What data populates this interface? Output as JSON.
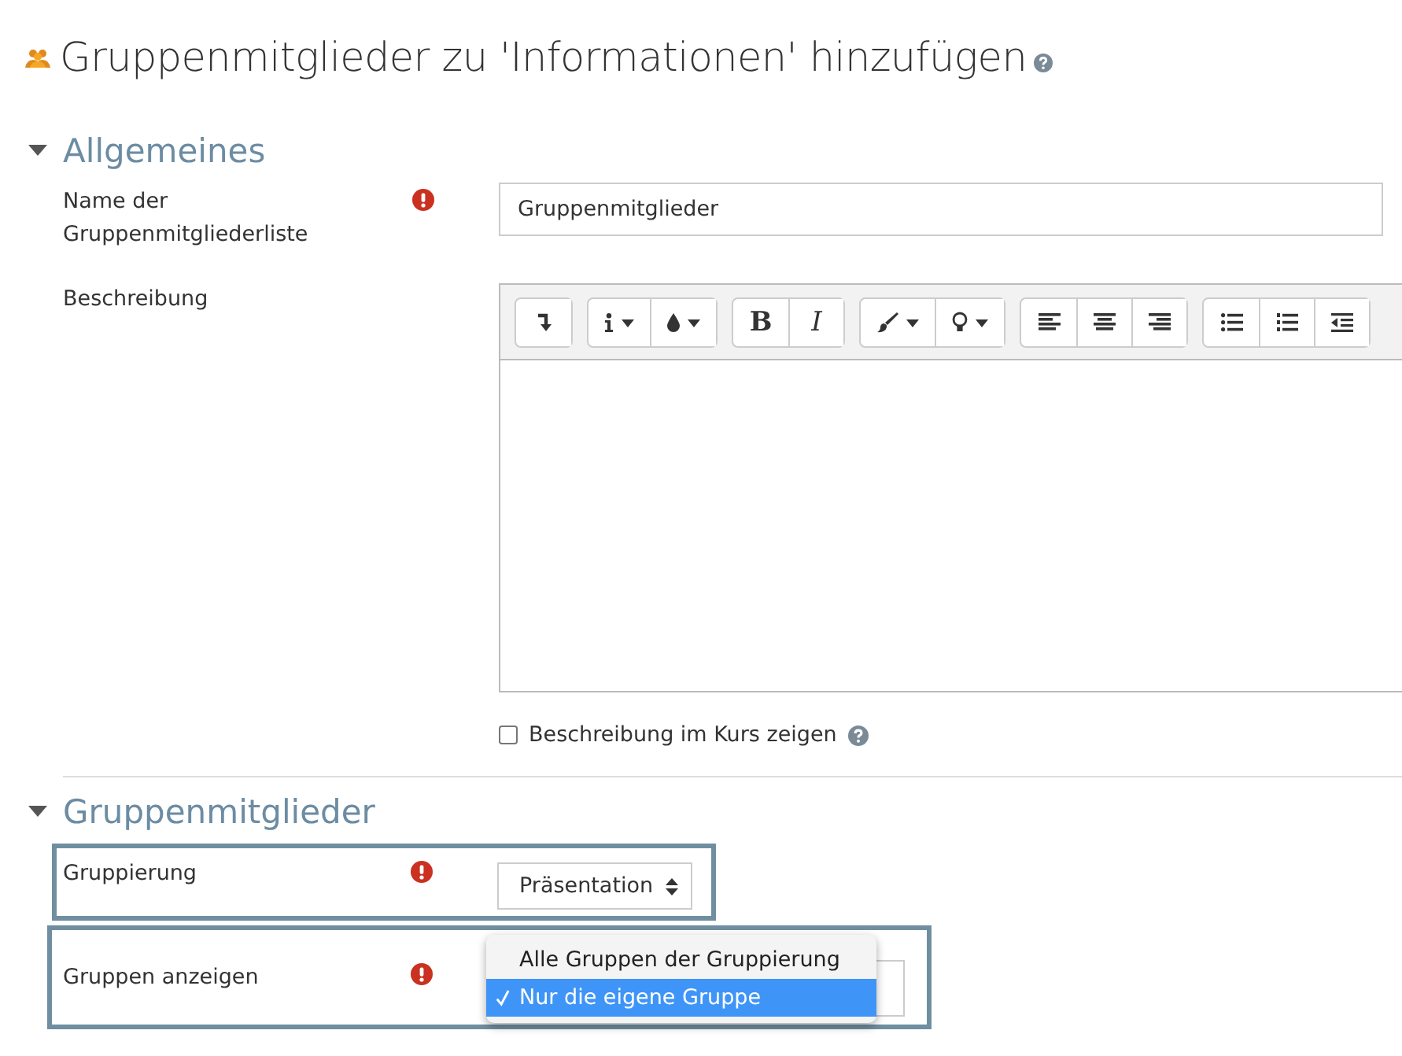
{
  "page_title": "Gruppenmitglieder zu 'Informationen' hinzufügen",
  "sections": [
    {
      "title": "Allgemeines",
      "expanded": true,
      "fields": [
        {
          "kind": "text",
          "label": "Name der Gruppenmitgliederliste",
          "required": true,
          "value": "Gruppenmitglieder",
          "highlighted": false
        },
        {
          "kind": "editor",
          "label": "Beschreibung",
          "required": false,
          "highlighted": false,
          "toolbar": [
            [
              {
                "kind": "collapse",
                "caret": false
              }
            ],
            [
              {
                "kind": "info",
                "caret": true
              },
              {
                "kind": "drop",
                "caret": true
              }
            ],
            [
              {
                "kind": "text",
                "label": "B",
                "caret": false
              },
              {
                "kind": "text-italic",
                "label": "I",
                "caret": false
              }
            ],
            [
              {
                "kind": "brush",
                "caret": true
              },
              {
                "kind": "bulb",
                "caret": true
              }
            ],
            [
              {
                "kind": "align-left",
                "caret": false
              },
              {
                "kind": "align-center",
                "caret": false
              },
              {
                "kind": "align-right",
                "caret": false
              }
            ],
            [
              {
                "kind": "ul",
                "caret": false
              },
              {
                "kind": "ol",
                "caret": false
              },
              {
                "kind": "outdent",
                "caret": false
              }
            ]
          ],
          "checkbox": {
            "label": "Beschreibung im Kurs zeigen",
            "checked": false
          }
        }
      ]
    },
    {
      "title": "Gruppenmitglieder",
      "expanded": true,
      "fields": [
        {
          "kind": "select",
          "label": "Gruppierung",
          "required": true,
          "value": "Präsentation",
          "highlighted": true
        },
        {
          "kind": "select-open",
          "label": "Gruppen anzeigen",
          "required": true,
          "highlighted": true,
          "options": [
            {
              "label": "Alle Gruppen der Gruppierung",
              "selected": false
            },
            {
              "label": "Nur die eigene Gruppe",
              "selected": true
            }
          ]
        }
      ]
    }
  ]
}
